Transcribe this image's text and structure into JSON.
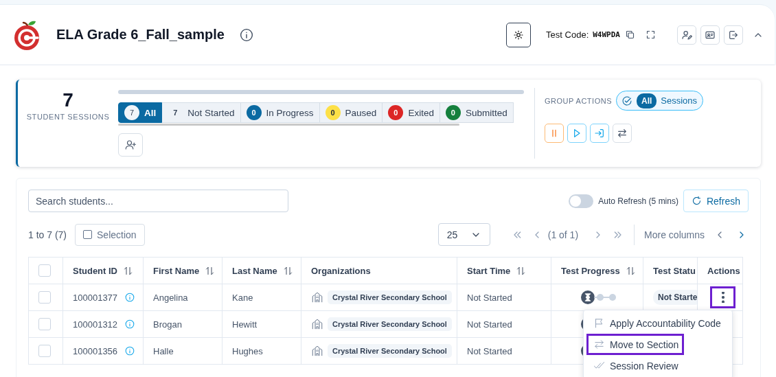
{
  "header": {
    "title": "ELA Grade 6_Fall_sample",
    "test_code_label": "Test Code:",
    "test_code": "W4WPDA"
  },
  "sessions": {
    "count": "7",
    "label": "STUDENT SESSIONS",
    "statuses": [
      {
        "count": "7",
        "label": "All",
        "selected": true
      },
      {
        "count": "7",
        "label": "Not Started",
        "selected": false
      },
      {
        "count": "0",
        "label": "In Progress",
        "selected": false,
        "color": "#0b6aa2"
      },
      {
        "count": "0",
        "label": "Paused",
        "selected": false,
        "color": "#fde047"
      },
      {
        "count": "0",
        "label": "Exited",
        "selected": false,
        "color": "#dc2626"
      },
      {
        "count": "0",
        "label": "Submitted",
        "selected": false,
        "color": "#15803d"
      }
    ]
  },
  "group_actions": {
    "label": "GROUP ACTIONS",
    "scope": "All",
    "scope_label": "Sessions"
  },
  "toolbar": {
    "search_placeholder": "Search students...",
    "auto_refresh": {
      "label": "Auto Refresh (5 mins)",
      "on": false
    },
    "refresh": "Refresh",
    "range": "1 to 7 (7)",
    "selection": "Selection",
    "page_size": "25",
    "page": "(1 of 1)",
    "more_columns": "More columns"
  },
  "table": {
    "select_all": {
      "checked": false
    },
    "columns": [
      {
        "label": "Student ID",
        "sortable": true
      },
      {
        "label": "First Name",
        "sortable": true
      },
      {
        "label": "Last Name",
        "sortable": true
      },
      {
        "label": "Organizations",
        "sortable": false
      },
      {
        "label": "Start Time",
        "sortable": true
      },
      {
        "label": "Test Progress",
        "sortable": true
      },
      {
        "label": "Test Statu",
        "sortable": false
      },
      {
        "label": "Actions",
        "sortable": false
      }
    ],
    "rows": [
      {
        "checked": false,
        "student_id": "100001377",
        "first_name": "Angelina",
        "last_name": "Kane",
        "organization": "Crystal River Secondary School",
        "start_time": "Not Started",
        "test_status": "Not Starte",
        "highlighted": true
      },
      {
        "checked": false,
        "student_id": "100001312",
        "first_name": "Brogan",
        "last_name": "Hewitt",
        "organization": "Crystal River Secondary School",
        "start_time": "Not Started",
        "highlighted": false
      },
      {
        "checked": false,
        "student_id": "100001356",
        "first_name": "Halle",
        "last_name": "Hughes",
        "organization": "Crystal River Secondary School",
        "start_time": "Not Started",
        "highlighted": false
      }
    ]
  },
  "menu": {
    "items": [
      {
        "kind": "flag",
        "label": "Apply Accountability Code",
        "highlighted": false
      },
      {
        "kind": "swap",
        "label": "Move to Section",
        "highlighted": true
      },
      {
        "kind": "check",
        "label": "Session Review",
        "highlighted": false
      }
    ]
  }
}
